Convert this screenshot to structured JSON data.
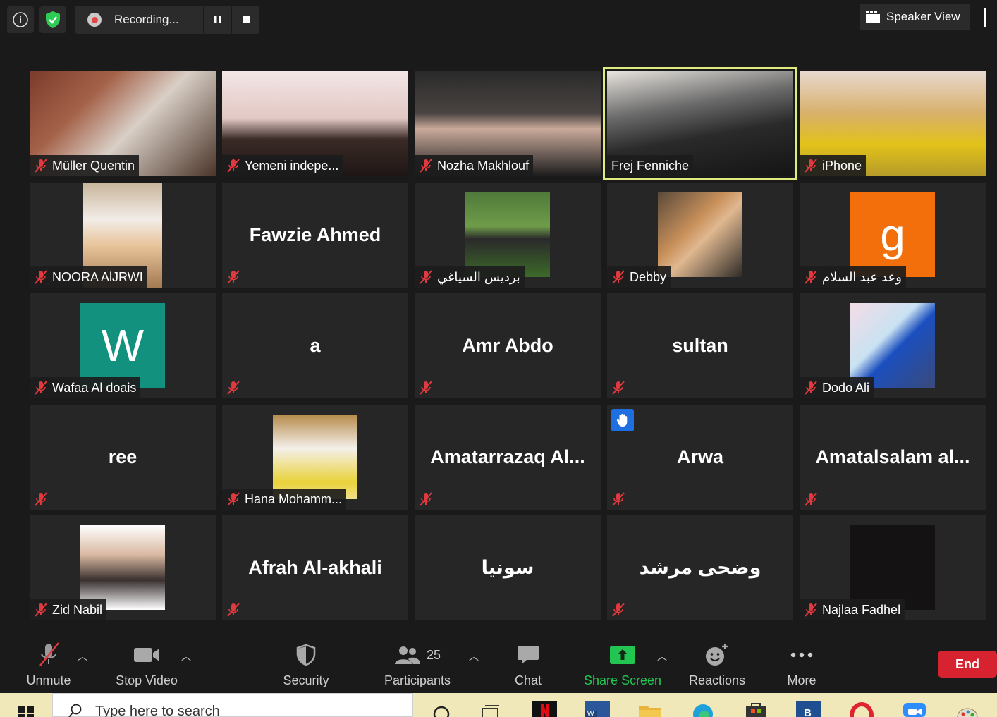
{
  "top_bar": {
    "info_icon": "info-icon",
    "security_icon": "shield-check-icon",
    "recording_label": "Recording...",
    "speaker_view_label": "Speaker View"
  },
  "participants": [
    {
      "name": "Müller Quentin",
      "type": "video",
      "muted": true
    },
    {
      "name": "Yemeni indepe...",
      "type": "video",
      "muted": true
    },
    {
      "name": "Nozha Makhlouf",
      "type": "video",
      "muted": true
    },
    {
      "name": "Frej Fenniche",
      "type": "video",
      "muted": false,
      "active": true
    },
    {
      "name": "iPhone",
      "type": "video",
      "muted": true
    },
    {
      "name": "NOORA AlJRWI",
      "type": "avatar",
      "muted": true
    },
    {
      "name": "Fawzie Ahmed",
      "type": "name",
      "muted": true
    },
    {
      "name": "برديس السياغي",
      "type": "avatar",
      "muted": true
    },
    {
      "name": "Debby",
      "type": "avatar",
      "muted": true
    },
    {
      "name": "وعد عبد السلام",
      "type": "avatar",
      "muted": true,
      "avatar_letter": "g"
    },
    {
      "name": "Wafaa Al doais",
      "type": "avatar",
      "muted": true,
      "avatar_letter": "W"
    },
    {
      "name": "a",
      "type": "name",
      "muted": true
    },
    {
      "name": "Amr Abdo",
      "type": "name",
      "muted": true
    },
    {
      "name": "sultan",
      "type": "name",
      "muted": true
    },
    {
      "name": "Dodo Ali",
      "type": "avatar",
      "muted": true
    },
    {
      "name": "ree",
      "type": "name",
      "muted": true
    },
    {
      "name": "Hana Mohamm...",
      "type": "avatar",
      "muted": true
    },
    {
      "name": "Amatarrazaq Al...",
      "type": "name",
      "muted": true
    },
    {
      "name": "Arwa",
      "type": "name",
      "muted": true,
      "hand_raised": true
    },
    {
      "name": "Amatalsalam al...",
      "type": "name",
      "muted": true
    },
    {
      "name": "Zid Nabil",
      "type": "avatar",
      "muted": true
    },
    {
      "name": "Afrah Al-akhali",
      "type": "name",
      "muted": true
    },
    {
      "name": "سونيا",
      "type": "name",
      "muted": false
    },
    {
      "name": "وضحى مرشد",
      "type": "name",
      "muted": true
    },
    {
      "name": "Najlaa Fadhel",
      "type": "avatar",
      "muted": true
    }
  ],
  "toolbar": {
    "unmute": "Unmute",
    "stop_video": "Stop Video",
    "security": "Security",
    "participants": "Participants",
    "participants_count": "25",
    "chat": "Chat",
    "share_screen": "Share Screen",
    "reactions": "Reactions",
    "more": "More",
    "end": "End"
  },
  "taskbar": {
    "search_placeholder": "Type here to search"
  },
  "colors": {
    "background": "#1a1a1a",
    "active_speaker_border": "#dfeb7e",
    "share_green": "#23c552",
    "end_red": "#d6232f",
    "mute_red": "#e0393e",
    "hand_blue": "#1f6fe0"
  }
}
